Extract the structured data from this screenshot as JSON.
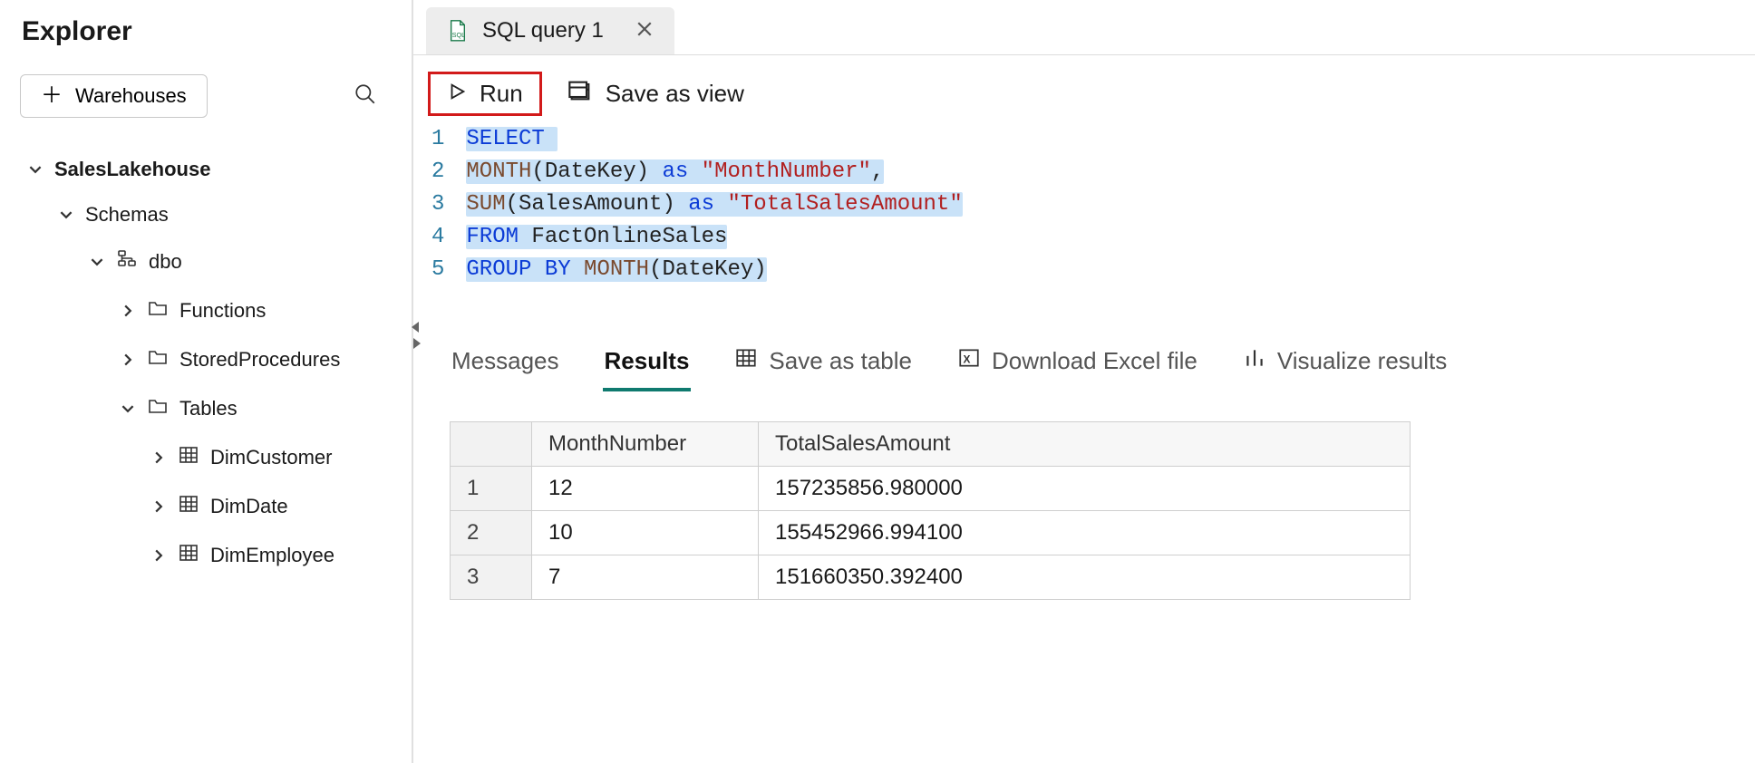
{
  "explorer": {
    "title": "Explorer",
    "warehouses_btn": "Warehouses",
    "tree": {
      "root": "SalesLakehouse",
      "schemas_label": "Schemas",
      "dbo_label": "dbo",
      "functions_label": "Functions",
      "storedprocs_label": "StoredProcedures",
      "tables_label": "Tables",
      "tables": [
        "DimCustomer",
        "DimDate",
        "DimEmployee"
      ]
    }
  },
  "tab": {
    "label": "SQL query 1"
  },
  "toolbar": {
    "run_label": "Run",
    "save_as_view_label": "Save as view"
  },
  "code": {
    "line_numbers": [
      "1",
      "2",
      "3",
      "4",
      "5"
    ],
    "l1": {
      "select": "SELECT"
    },
    "l2": {
      "month": "MONTH",
      "paren_dk": "(DateKey)",
      "as": "as",
      "alias": "\"MonthNumber\"",
      "comma": ","
    },
    "l3": {
      "sum": "SUM",
      "paren_sa": "(SalesAmount)",
      "as": "as",
      "alias": "\"TotalSalesAmount\""
    },
    "l4": {
      "from": "FROM",
      "table": "FactOnlineSales"
    },
    "l5": {
      "group": "GROUP",
      "by": "BY",
      "month": "MONTH",
      "paren_dk": "(DateKey)"
    }
  },
  "results": {
    "tab_messages": "Messages",
    "tab_results": "Results",
    "btn_save_table": "Save as table",
    "btn_download_excel": "Download Excel file",
    "btn_visualize": "Visualize results",
    "columns": [
      "MonthNumber",
      "TotalSalesAmount"
    ],
    "rows": [
      {
        "n": "1",
        "month": "12",
        "total": "157235856.980000"
      },
      {
        "n": "2",
        "month": "10",
        "total": "155452966.994100"
      },
      {
        "n": "3",
        "month": "7",
        "total": "151660350.392400"
      }
    ]
  }
}
